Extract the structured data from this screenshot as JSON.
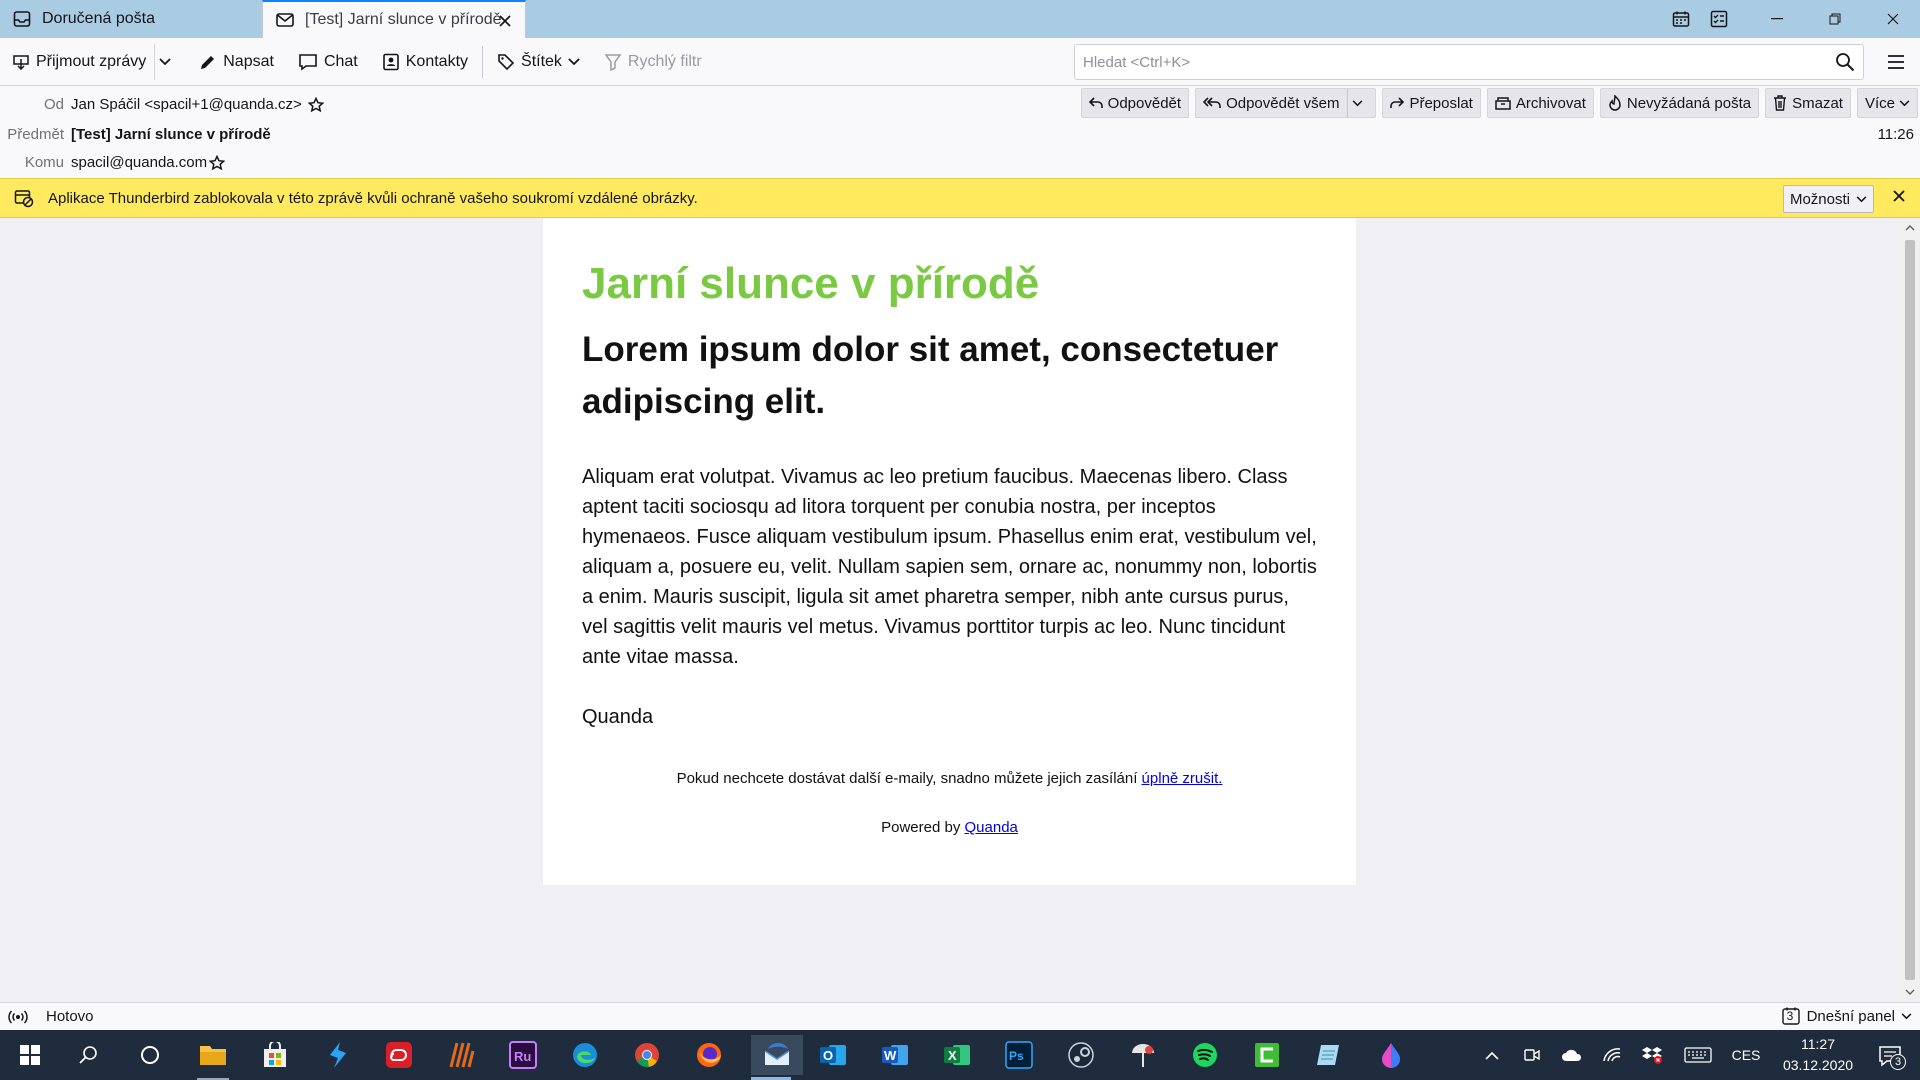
{
  "tabs": [
    {
      "label": "Doručená pošta",
      "icon": "inbox-icon"
    },
    {
      "label": "[Test] Jarní slunce v přírodě",
      "icon": "envelope-icon"
    }
  ],
  "toolbar": {
    "get_messages": "Přijmout zprávy",
    "write": "Napsat",
    "chat": "Chat",
    "contacts": "Kontakty",
    "tag": "Štítek",
    "quick_filter": "Rychlý filtr",
    "search_placeholder": "Hledat <Ctrl+K>"
  },
  "header": {
    "from_label": "Od",
    "from_value": "Jan Spáčil <spacil+1@quanda.cz>",
    "subject_label": "Předmět",
    "subject_value": "[Test] Jarní slunce v přírodě",
    "to_label": "Komu",
    "to_value": "spacil@quanda.com",
    "time": "11:26",
    "buttons": {
      "reply": "Odpovědět",
      "reply_all": "Odpovědět všem",
      "forward": "Přeposlat",
      "archive": "Archivovat",
      "junk": "Nevyžádaná pošta",
      "delete": "Smazat",
      "more": "Více"
    }
  },
  "notification": {
    "text": "Aplikace Thunderbird zablokovala v této zprávě kvůli ochraně vašeho soukromí vzdálené obrázky.",
    "options": "Možnosti"
  },
  "email": {
    "title": "Jarní slunce v přírodě",
    "heading": "Lorem ipsum dolor sit amet, consectetuer adipiscing elit.",
    "body": "Aliquam erat volutpat. Vivamus ac leo pretium faucibus. Maecenas libero. Class aptent taciti sociosqu ad litora torquent per conubia nostra, per inceptos hymenaeos. Fusce aliquam vestibulum ipsum. Phasellus enim erat, vestibulum vel, aliquam a, posuere eu, velit. Nullam sapien sem, ornare ac, nonummy non, lobortis a enim. Mauris suscipit, ligula sit amet pharetra semper, nibh ante cursus purus, vel sagittis velit mauris vel metus. Vivamus porttitor turpis ac leo. Nunc tincidunt ante vitae massa.",
    "signature": "Quanda",
    "unsubscribe_text": "Pokud nechcete dostávat další e-maily, snadno můžete jejich zasílání",
    "unsubscribe_link": "úplně zrušit.",
    "powered_text": "Powered by",
    "powered_link": "Quanda",
    "title_color": "#7ac943"
  },
  "status": {
    "text": "Hotovo",
    "today_panel": "Dnešní panel",
    "today_day": "3"
  },
  "taskbar": {
    "language": "CES",
    "time": "11:27",
    "date": "03.12.2020",
    "notifications": "3"
  }
}
